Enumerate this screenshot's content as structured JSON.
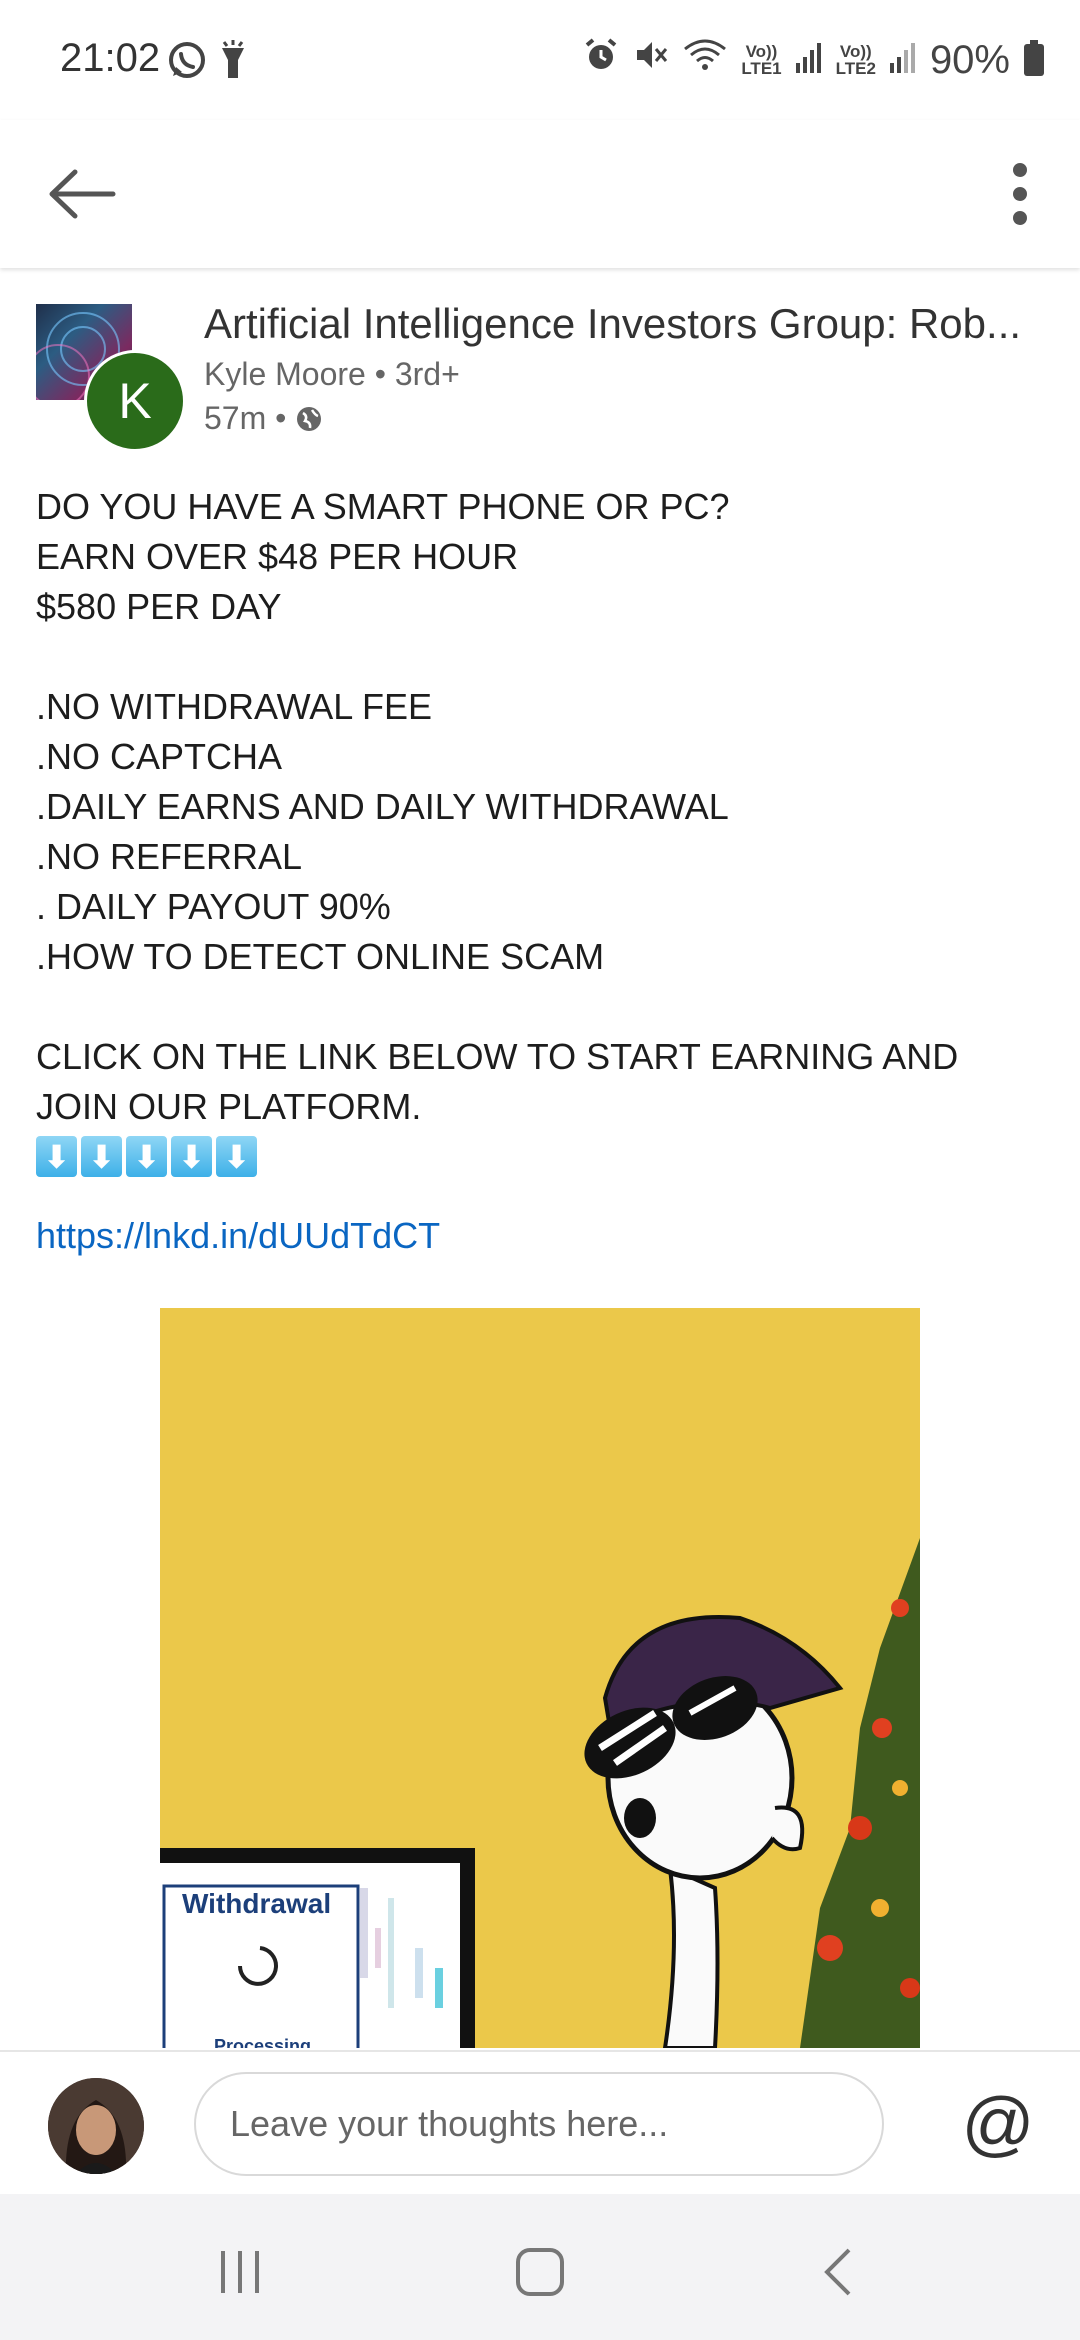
{
  "status_bar": {
    "time": "21:02",
    "battery": "90%",
    "sim1_top": "Vo))",
    "sim1_bottom": "LTE1",
    "sim2_top": "Vo))",
    "sim2_bottom": "LTE2",
    "icons": [
      "whatsapp-icon",
      "flashlight-icon",
      "alarm-icon",
      "mute-icon",
      "wifi-icon",
      "signal-icon",
      "battery-icon"
    ]
  },
  "app_bar": {
    "icons": [
      "back-arrow-icon",
      "more-vert-icon"
    ]
  },
  "post": {
    "group_name": "Artificial Intelligence Investors Group: Rob...",
    "author": "Kyle Moore",
    "degree": "3rd+",
    "author_line": "Kyle Moore • 3rd+",
    "time": "57m •",
    "avatar_initial": "K",
    "lines": [
      "DO YOU HAVE A SMART PHONE OR PC?",
      "EARN OVER $48 PER HOUR",
      "$580 PER DAY",
      ".NO WITHDRAWAL FEE",
      ".NO CAPTCHA",
      ".DAILY EARNS AND DAILY WITHDRAWAL",
      ".NO REFERRAL",
      ". DAILY PAYOUT 90%",
      ".HOW TO DETECT ONLINE SCAM",
      "CLICK ON THE LINK BELOW TO START EARNING AND JOIN OUR PLATFORM."
    ],
    "arrows": [
      "⬇",
      "⬇",
      "⬇",
      "⬇",
      "⬇"
    ],
    "link": "https://lnkd.in/dUUdTdCT",
    "media": {
      "withdrawal_label": "Withdrawal",
      "processing_label": "Processing"
    }
  },
  "comment_bar": {
    "placeholder": "Leave your thoughts here...",
    "mention_label": "@"
  },
  "nav_bar": {
    "icons": [
      "recent-apps-icon",
      "home-icon",
      "back-icon"
    ]
  },
  "colors": {
    "link": "#0a66c2",
    "avatar_bg": "#2a6b1a",
    "media_bg": "#ebc84a"
  }
}
